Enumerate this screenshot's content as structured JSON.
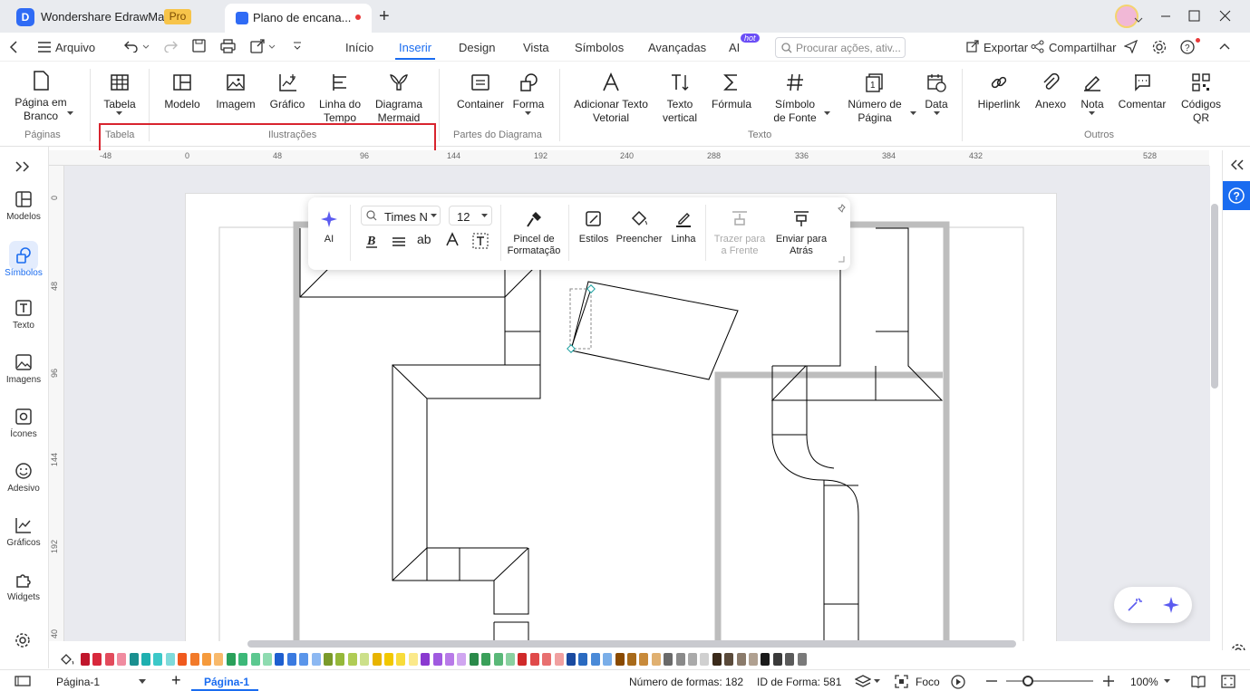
{
  "app": {
    "name": "Wondershare EdrawMax",
    "badge": "Pro",
    "tab_title": "Plano de encana...",
    "new_tab": "+"
  },
  "menu": {
    "arquivo": "Arquivo",
    "tabs": [
      "Início",
      "Inserir",
      "Design",
      "Vista",
      "Símbolos",
      "Avançadas",
      "AI"
    ],
    "hot": "hot",
    "search_placeholder": "Procurar ações, ativ...",
    "exportar": "Exportar",
    "compartilhar": "Compartilhar"
  },
  "ribbon": {
    "pagina_em_branco": [
      "Página em",
      "Branco"
    ],
    "tabela": "Tabela",
    "modelo": "Modelo",
    "imagem": "Imagem",
    "grafico": "Gráfico",
    "linha_tempo": [
      "Linha do",
      "Tempo"
    ],
    "mermaid": [
      "Diagrama",
      "Mermaid"
    ],
    "container": "Container",
    "forma": "Forma",
    "texto_vetorial": [
      "Adicionar Texto",
      "Vetorial"
    ],
    "texto_vertical": [
      "Texto",
      "vertical"
    ],
    "formula": "Fórmula",
    "simbolo_fonte": [
      "Símbolo",
      "de Fonte"
    ],
    "numero_pagina": [
      "Número de",
      "Página"
    ],
    "data": "Data",
    "hiperlink": "Hiperlink",
    "anexo": "Anexo",
    "nota": "Nota",
    "comentar": "Comentar",
    "codigos_qr": [
      "Códigos",
      "QR"
    ],
    "groups": {
      "paginas": "Páginas",
      "tabela": "Tabela",
      "ilustracoes": "Ilustrações",
      "partes": "Partes do Diagrama",
      "texto": "Texto",
      "outros": "Outros"
    }
  },
  "sidebar": [
    "Modelos",
    "Símbolos",
    "Texto",
    "Imagens",
    "Ícones",
    "Adesivo",
    "Gráficos",
    "Widgets"
  ],
  "ruler": {
    "top": [
      "-48",
      "0",
      "48",
      "96",
      "144",
      "192",
      "240",
      "288",
      "336",
      "384",
      "432",
      "528"
    ],
    "left": [
      "0",
      "48",
      "96",
      "144",
      "192",
      "40"
    ]
  },
  "float_toolbar": {
    "ai": "AI",
    "font": "Times N",
    "size": "12",
    "pincel": [
      "Pincel de",
      "Formatação"
    ],
    "estilos": "Estilos",
    "preencher": "Preencher",
    "linha": "Linha",
    "trazer": [
      "Trazer para",
      "a Frente"
    ],
    "enviar": [
      "Enviar para",
      "Atrás"
    ]
  },
  "status": {
    "page_select": "Página-1",
    "page_tab": "Página-1",
    "num_formas": "Número de formas: 182",
    "id_forma": "ID de Forma: 581",
    "foco": "Foco",
    "zoom": "100%"
  },
  "palette": [
    "#c0162c",
    "#d8283c",
    "#e24b5c",
    "#f08ca0",
    "#1a8f8f",
    "#1fb0b0",
    "#3cc8c8",
    "#7fdada",
    "#f05a1e",
    "#f27a2a",
    "#f59a3c",
    "#f8b96b",
    "#2aa05a",
    "#3cb878",
    "#5cc890",
    "#8edbb0",
    "#1e5fd0",
    "#3a7ae0",
    "#5a95ea",
    "#8cb8f2",
    "#7a9a2a",
    "#95b83a",
    "#b0cc55",
    "#cce08a",
    "#e8b400",
    "#f2c800",
    "#f8dc3a",
    "#fbe98a",
    "#8a3ad0",
    "#a05ae0",
    "#b87ae8",
    "#d0a6f0",
    "#2a8a4a",
    "#3aa05a",
    "#5ab878",
    "#8ad0a0",
    "#d02a2a",
    "#e04a4a",
    "#e87070",
    "#f0a0a0",
    "#1a4aa0",
    "#2a6ac0",
    "#4a8ad8",
    "#7aaee8",
    "#8a4a00",
    "#a86a1a",
    "#c88a3a",
    "#e0b070",
    "#6a6a6a",
    "#8a8a8a",
    "#aaaaaa",
    "#d0d0d0",
    "#3a2a1a",
    "#5a4a3a",
    "#8a7a6a",
    "#b0a090",
    "#1a1a1a",
    "#3a3a3a",
    "#5a5a5a",
    "#7a7a7a"
  ]
}
